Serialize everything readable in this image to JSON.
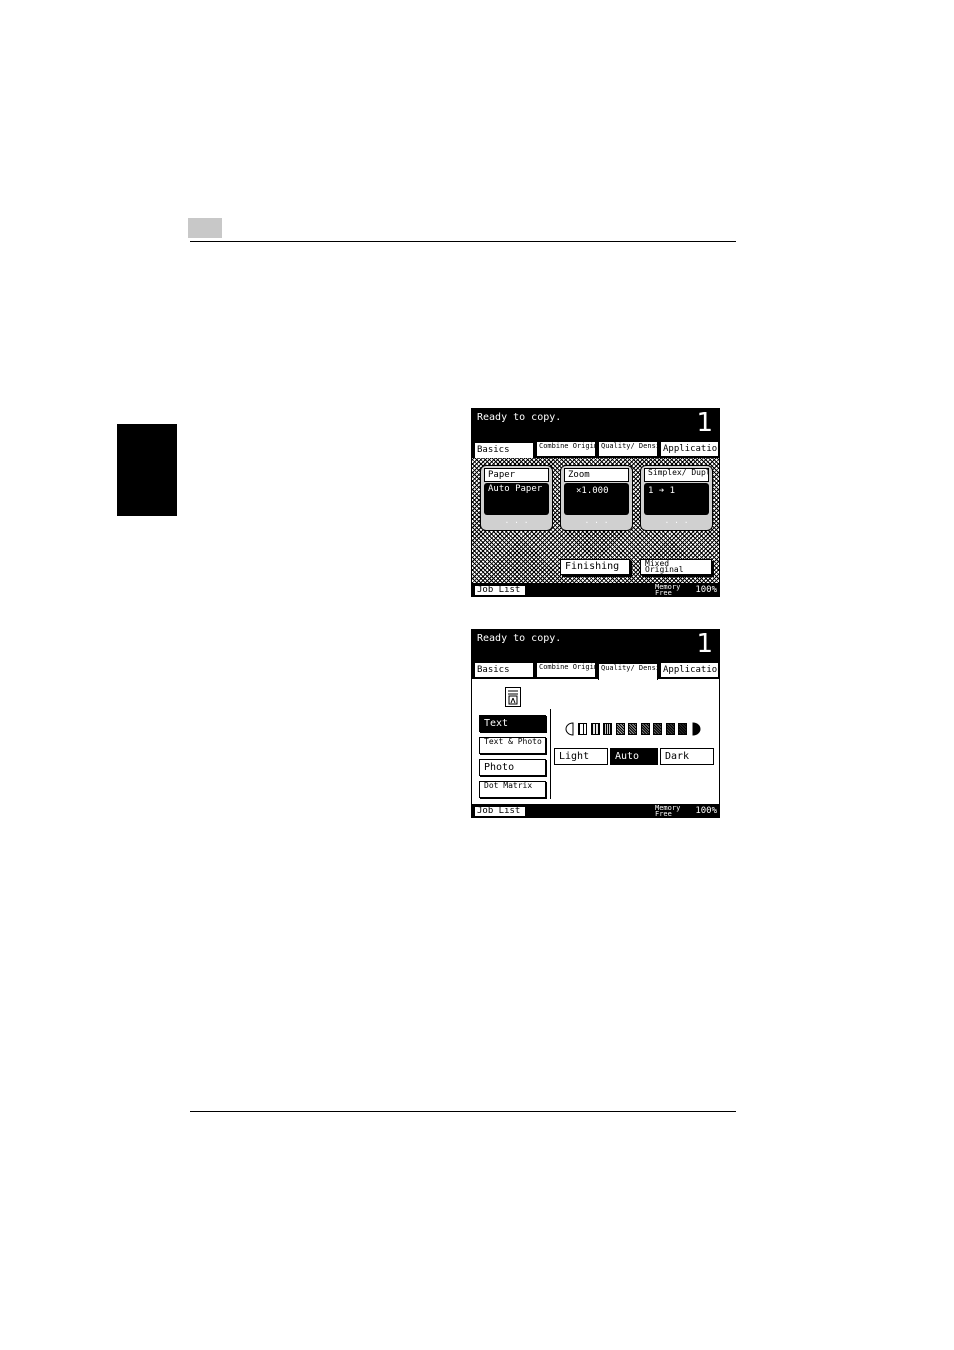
{
  "screen1": {
    "status": "Ready to copy.",
    "count": "1",
    "tabs": [
      {
        "label": "Basics"
      },
      {
        "label": "Combine Originals"
      },
      {
        "label": "Quality/ Density"
      },
      {
        "label": "Application"
      }
    ],
    "panels": [
      {
        "title": "Paper",
        "value": "Auto Paper"
      },
      {
        "title": "Zoom",
        "value": "×1.000"
      },
      {
        "title": "Simplex/ Duplex",
        "value": "1 ➔ 1"
      }
    ],
    "finishing": "Finishing",
    "mixed_original": "Mixed Original",
    "job_list": "Job List",
    "memory_free": "Memory Free",
    "memory_pct": "100%"
  },
  "screen2": {
    "status": "Ready to copy.",
    "count": "1",
    "tabs": [
      {
        "label": "Basics"
      },
      {
        "label": "Combine Originals"
      },
      {
        "label": "Quality/ Density"
      },
      {
        "label": "Application"
      }
    ],
    "quality_options": [
      {
        "label": "Text",
        "selected": true
      },
      {
        "label": "Text & Photo",
        "selected": false
      },
      {
        "label": "Photo",
        "selected": false
      },
      {
        "label": "Dot Matrix",
        "selected": false
      }
    ],
    "density_options": [
      {
        "label": "Light",
        "selected": false
      },
      {
        "label": "Auto",
        "selected": true
      },
      {
        "label": "Dark",
        "selected": false
      }
    ],
    "density_level": 9,
    "job_list": "Job List",
    "memory_free": "Memory Free",
    "memory_pct": "100%"
  }
}
